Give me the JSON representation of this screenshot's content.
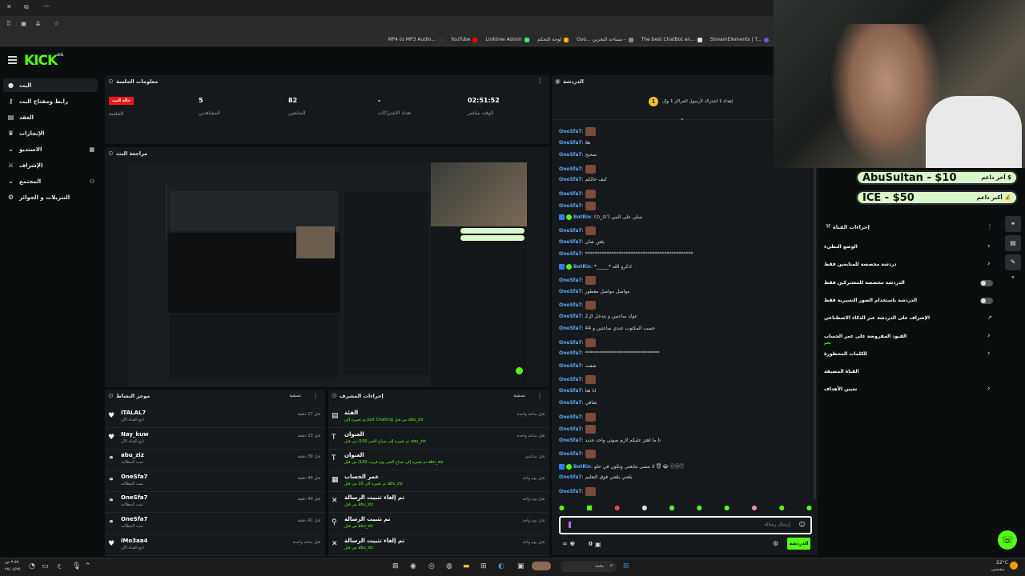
{
  "browser": {
    "bookmarks": [
      "MP4 to MP3 Audio...",
      "YouTube",
      "Linktree Admin",
      "لوحة التحكم",
      "Goo... مساحة التخزين -",
      "The best ChatBot an...",
      "StreamElements | T..."
    ]
  },
  "sidebar": {
    "items": [
      {
        "label": "البث",
        "icon": "home-icon"
      },
      {
        "label": "رابط ومفتاح البث",
        "icon": "key-icon"
      },
      {
        "label": "العقد",
        "icon": "document-icon"
      },
      {
        "label": "الإنجازات",
        "icon": "trophy-icon"
      },
      {
        "label": "الاستديو",
        "icon": "studio-icon"
      },
      {
        "label": "الإشراف",
        "icon": "shield-icon"
      },
      {
        "label": "المجتمع",
        "icon": "community-icon"
      },
      {
        "label": "التنزيلات و الجوائز",
        "icon": "gift-icon"
      }
    ]
  },
  "session": {
    "title": "معلومات الجلسة",
    "live_badge": "حالة البث",
    "stats": [
      {
        "label": "الجلسة",
        "value": ""
      },
      {
        "label": "المشاهدين",
        "value": "5"
      },
      {
        "label": "المتابعين",
        "value": "82"
      },
      {
        "label": "تعداد الاشتراكات",
        "value": "-"
      },
      {
        "label": "الوقت مباشر",
        "value": "02:51:52"
      }
    ]
  },
  "preview": {
    "title": "مراجعة البث"
  },
  "activity": {
    "title": "موجز النشاط",
    "filter": "تصفية",
    "rows": [
      {
        "name": "iTALAL7",
        "sub": "تابع القناة الآن",
        "time": "قبل 17 دقيقة",
        "icon": "heart-icon"
      },
      {
        "name": "Nay_kuw",
        "sub": "تابع القناة الآن",
        "time": "قبل 33 دقيقة",
        "icon": "heart-icon"
      },
      {
        "name": "abu_ziz",
        "sub": "تمت المطالبة",
        "time": "قبل 39 دقيقة",
        "icon": "share-icon"
      },
      {
        "name": "OneSfa7",
        "sub": "تمت المطالبة",
        "time": "قبل 40 دقيقة",
        "icon": "share-icon"
      },
      {
        "name": "OneSfa7",
        "sub": "تمت المطالبة",
        "time": "قبل 40 دقيقة",
        "icon": "share-icon"
      },
      {
        "name": "OneSfa7",
        "sub": "تمت المطالبة",
        "time": "قبل 41 دقيقة",
        "icon": "share-icon"
      },
      {
        "name": "iMo3aa4",
        "sub": "تابع القناة الآن",
        "time": "قبل ساعة واحدة",
        "icon": "heart-icon"
      }
    ]
  },
  "modactions": {
    "title": "إجراءات المشرف",
    "filter": "تصفية",
    "rows": [
      {
        "name": "الفئة",
        "sub": "تم تغييره إلى Just Chatting من قبل abu_ziz",
        "time": "قبل ساعة واحدة",
        "icon": "category-icon"
      },
      {
        "name": "العنوان",
        "sub": "تم تغييره إلى صباح الخير 100/ من قبل abu_ziz",
        "time": "قبل ساعة واحدة",
        "icon": "title-icon"
      },
      {
        "name": "العنوان",
        "sub": "تم تغييره إلى صباح الخير يوم قريب 100/ من قبل abu_ziz",
        "time": "قبل ساعتين",
        "icon": "title-icon"
      },
      {
        "name": "عمر الحساب",
        "sub": "تم تغييره الى 10 من قبل abu_ziz",
        "time": "قبل يوم واحد",
        "icon": "calendar-icon"
      },
      {
        "name": "تم إلغاء تثبيت الرسالة",
        "sub": "من قبل abu_ziz",
        "time": "قبل يوم واحد",
        "icon": "unpin-icon"
      },
      {
        "name": "تم تثبيت الرسالة",
        "sub": "من قبل abu_ziz",
        "time": "قبل يوم واحد",
        "icon": "pin-icon"
      },
      {
        "name": "تم إلغاء تثبيت الرسالة",
        "sub": "من قبل abu_ziz",
        "time": "قبل يوم واحد",
        "icon": "unpin-icon"
      }
    ]
  },
  "chat": {
    "title": "الدردشة",
    "pinned": "إهداء 1 اشتراك لأرسول المراكز 1 وإل",
    "messages": [
      {
        "user": "OneSfa7",
        "text": "",
        "emote": true
      },
      {
        "user": "OneSfa7",
        "text": "هلا",
        "emote": false
      },
      {
        "user": "OneSfa7",
        "text": "صحيح",
        "emote": false
      },
      {
        "user": "OneSfa7",
        "text": "",
        "emote": true
      },
      {
        "user": "OneSfa7",
        "text": "كيف حالكم",
        "emote": false
      },
      {
        "user": "OneSfa7",
        "text": "",
        "emote": true
      },
      {
        "user": "OneSfa7",
        "text": "",
        "emote": true
      },
      {
        "user": "BotRix",
        "text": "(⊙_⊙') سلي على النبي",
        "emote": false,
        "bot": true
      },
      {
        "user": "OneSfa7",
        "text": "",
        "emote": true
      },
      {
        "user": "OneSfa7",
        "text": "يلعن شان",
        "emote": false
      },
      {
        "user": "OneSfa7",
        "text": "*********************************************",
        "emote": false
      },
      {
        "user": "BotRix",
        "text": "*_____* اذكرو الله",
        "emote": false,
        "bot": true
      },
      {
        "user": "OneSfa7",
        "text": "",
        "emote": true
      },
      {
        "user": "OneSfa7",
        "text": "مواصل مواصل معطور",
        "emote": false
      },
      {
        "user": "OneSfa7",
        "text": "",
        "emote": true
      },
      {
        "user": "OneSfa7",
        "text": "عوك ساعتين و بتدخل ال2",
        "emote": false
      },
      {
        "user": "OneSfa7",
        "text": "حسب المكتوب عندي ساعتين و 44",
        "emote": false
      },
      {
        "user": "OneSfa7",
        "text": "",
        "emote": true
      },
      {
        "user": "OneSfa7",
        "text": "*******************************",
        "emote": false
      },
      {
        "user": "OneSfa7",
        "text": "شفت",
        "emote": false
      },
      {
        "user": "OneSfa7",
        "text": "",
        "emote": true
      },
      {
        "user": "OneSfa7",
        "text": "انا هنا",
        "emote": false
      },
      {
        "user": "OneSfa7",
        "text": "شافي",
        "emote": false
      },
      {
        "user": "OneSfa7",
        "text": "",
        "emote": true
      },
      {
        "user": "OneSfa7",
        "text": "",
        "emote": true
      },
      {
        "user": "OneSfa7",
        "text": "تا ما اهتز عليكم لازم صوتي واحد جديد",
        "emote": false
      },
      {
        "user": "OneSfa7",
        "text": "",
        "emote": true
      },
      {
        "user": "BotRix",
        "text": "لا تنسى تتابعني وتكون في حلو 😇 😂 ⓒⓞⓕ",
        "emote": false,
        "bot": true
      },
      {
        "user": "OneSfa7",
        "text": "يلعني يلعني فوق التعليم",
        "emote": false
      },
      {
        "user": "OneSfa7",
        "text": "",
        "emote": true
      }
    ],
    "input_placeholder": "إرسال رسالة",
    "send_label": "الدردشة",
    "viewer_count": "0"
  },
  "modpanel": {
    "title": "إجراءات القناة",
    "rows": [
      {
        "label": "الوضع البطيء",
        "type": "chevron"
      },
      {
        "label": "دردشة مخصصة للمتابعين فقط",
        "type": "chevron"
      },
      {
        "label": "الدردشة مخصصة للمشتركين فقط",
        "type": "toggle"
      },
      {
        "label": "الدردشة باستخدام الصور التعبيرية فقط",
        "type": "toggle"
      },
      {
        "label": "الإشراف على الدردشة عبر الذكاء الاصطناعي",
        "type": "link"
      },
      {
        "label": "القيود المفروضة على عمر الحساب",
        "sub": "نعم",
        "type": "chevron"
      },
      {
        "label": "الكلمات المحظورة",
        "type": "chevron"
      },
      {
        "label": "القناة المضيفة",
        "type": "none"
      },
      {
        "label": "تعيين الأهداف",
        "type": "chevron"
      }
    ]
  },
  "donors": {
    "latest_label": "آخر داعم",
    "latest_value": "AbuSultan - $10",
    "top_label": "أكبر داعم",
    "top_value": "ICE - $50"
  },
  "taskbar": {
    "left_time": "٣:٥٧ ص",
    "left_date": "٢٧/٠٨/٢٥",
    "lang": "ع",
    "search": "بحث",
    "weather": "22°C",
    "weather_desc": "مشمس"
  },
  "colors": {
    "accent": "#53fc18",
    "chat_user": "#5aa9ff",
    "live": "#e91916"
  }
}
